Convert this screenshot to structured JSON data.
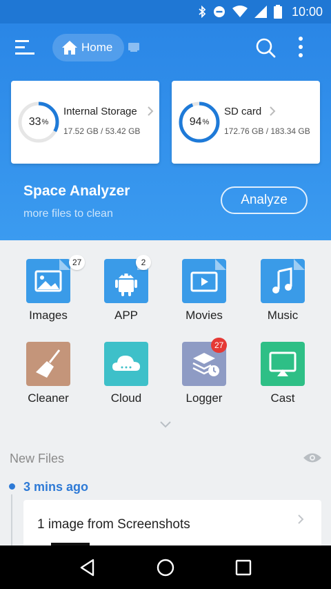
{
  "status_bar": {
    "time": "10:00"
  },
  "header": {
    "breadcrumb_label": "Home"
  },
  "storage": [
    {
      "percent": "33",
      "percent_unit": "%",
      "percent_value": 0.33,
      "title": "Internal Storage",
      "size": "17.52 GB / 53.42 GB"
    },
    {
      "percent": "94",
      "percent_unit": "%",
      "percent_value": 0.94,
      "title": "SD card",
      "size": "172.76 GB / 183.34 GB"
    }
  ],
  "space_analyzer": {
    "title": "Space Analyzer",
    "subtitle": "more files to clean",
    "button": "Analyze"
  },
  "categories": [
    {
      "label": "Images",
      "badge": "27",
      "badge_style": "white",
      "icon": "image-icon",
      "color": "#3a9be8"
    },
    {
      "label": "APP",
      "badge": "2",
      "badge_style": "white",
      "icon": "android-icon",
      "color": "#3a9be8"
    },
    {
      "label": "Movies",
      "badge": "",
      "badge_style": "",
      "icon": "video-icon",
      "color": "#3a9be8"
    },
    {
      "label": "Music",
      "badge": "",
      "badge_style": "",
      "icon": "music-note-icon",
      "color": "#3a9be8"
    },
    {
      "label": "Cleaner",
      "badge": "",
      "badge_style": "",
      "icon": "broom-icon",
      "color": "#c4957a"
    },
    {
      "label": "Cloud",
      "badge": "",
      "badge_style": "",
      "icon": "cloud-icon",
      "color": "#3ec0c9"
    },
    {
      "label": "Logger",
      "badge": "27",
      "badge_style": "red",
      "icon": "layers-clock-icon",
      "color": "#8e9bc4"
    },
    {
      "label": "Cast",
      "badge": "",
      "badge_style": "",
      "icon": "cast-icon",
      "color": "#2ebf86"
    }
  ],
  "new_files": {
    "heading": "New Files",
    "groups": [
      {
        "time_ago": "3 mins ago",
        "title": "1 image from Screenshots"
      }
    ]
  },
  "colors": {
    "accent": "#2e7ad6",
    "header_blue": "#2a86e6",
    "badge_red": "#e53935"
  }
}
